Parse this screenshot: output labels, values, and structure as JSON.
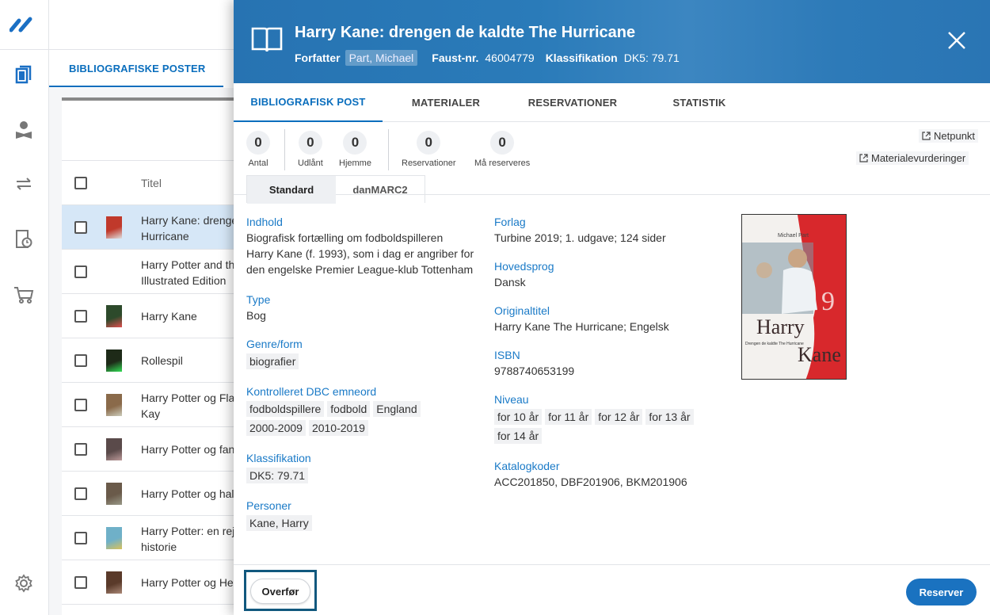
{
  "rail": {
    "icons": [
      "logo-icon",
      "books-icon",
      "user-reading-icon",
      "transfer-icon",
      "clock-book-icon",
      "cart-icon",
      "settings-icon"
    ]
  },
  "list": {
    "tab_label": "BIBLIOGRAFISKE POSTER",
    "column_title": "Titel",
    "rows": [
      {
        "line1": "Harry Kane: drengen de kaldte The",
        "line2": "Hurricane",
        "selected": true
      },
      {
        "line1": "Harry Potter and the",
        "line2": "Illustrated Edition",
        "selected": false
      },
      {
        "line1": "Harry Kane",
        "line2": "",
        "selected": false
      },
      {
        "line1": "Rollespil",
        "line2": "",
        "selected": false
      },
      {
        "line1": "Harry Potter og Flamels",
        "line2": "Kay",
        "selected": false
      },
      {
        "line1": "Harry Potter og fangen",
        "line2": "",
        "selected": false
      },
      {
        "line1": "Harry Potter og halvblodsprinsen",
        "line2": "",
        "selected": false
      },
      {
        "line1": "Harry Potter: en rejse gennem",
        "line2": "historie",
        "selected": false
      },
      {
        "line1": "Harry Potter og Hemmelighedernes",
        "line2": "",
        "selected": false
      }
    ]
  },
  "modal": {
    "title": "Harry Kane: drengen de kaldte The Hurricane",
    "author_label": "Forfatter",
    "author": "Part, Michael",
    "faust_label": "Faust-nr.",
    "faust": "46004779",
    "class_label": "Klassifikation",
    "class": "DK5: 79.71",
    "tabs": [
      "BIBLIOGRAFISK POST",
      "MATERIALER",
      "RESERVATIONER",
      "STATISTIK"
    ],
    "counts": [
      {
        "num": "0",
        "label": "Antal"
      },
      {
        "num": "0",
        "label": "Udlånt"
      },
      {
        "num": "0",
        "label": "Hjemme"
      },
      {
        "num": "0",
        "label": "Reservationer"
      },
      {
        "num": "0",
        "label": "Må reserveres"
      }
    ],
    "links": {
      "netpunkt": "Netpunkt",
      "materialevurderinger": "Materialevurderinger"
    },
    "view_tabs": [
      "Standard",
      "danMARC2"
    ],
    "fields_left": {
      "indhold_label": "Indhold",
      "indhold": [
        "Biografisk fortælling om fodboldspilleren",
        "Harry Kane (f. 1993), som i dag er angriber for",
        "den engelske Premier League-klub Tottenham"
      ],
      "type_label": "Type",
      "type": "Bog",
      "genre_label": "Genre/form",
      "genre": [
        "biografier"
      ],
      "emneord_label": "Kontrolleret DBC emneord",
      "emneord": [
        "fodboldspillere",
        "fodbold",
        "England",
        "2000-2009",
        "2010-2019"
      ],
      "klass_label": "Klassifikation",
      "klass": [
        "DK5: 79.71"
      ],
      "personer_label": "Personer",
      "personer": [
        "Kane, Harry"
      ]
    },
    "fields_right": {
      "forlag_label": "Forlag",
      "forlag": "Turbine 2019; 1. udgave; 124 sider",
      "sprog_label": "Hovedsprog",
      "sprog": "Dansk",
      "orig_label": "Originaltitel",
      "orig": "Harry Kane The Hurricane; Engelsk",
      "isbn_label": "ISBN",
      "isbn": "9788740653199",
      "niveau_label": "Niveau",
      "niveau": [
        "for 10 år",
        "for 11 år",
        "for 12 år",
        "for 13 år",
        "for 14 år"
      ],
      "katalog_label": "Katalogkoder",
      "katalog": "ACC201850, DBF201906, BKM201906"
    },
    "cover": {
      "author": "Michael Part",
      "title1": "Harry",
      "title2": "Kane",
      "number": "9",
      "subtitle": "Drengen de kaldte The Hurricane"
    },
    "footer": {
      "transfer": "Overfør",
      "reserve": "Reserver"
    }
  },
  "colors": {
    "accent": "#0a6ebd",
    "header": "#2a78b6",
    "reserve_button": "#1a72c0",
    "highlight_border": "#11587e"
  }
}
